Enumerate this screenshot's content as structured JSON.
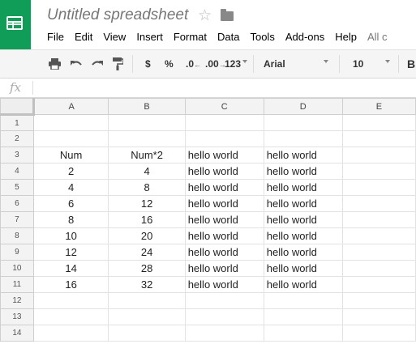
{
  "app": {
    "title": "Untitled spreadsheet",
    "brand_color": "#0f9d58",
    "icons": [
      "sheets-logo-icon",
      "star-icon",
      "folder-icon"
    ]
  },
  "menu": [
    "File",
    "Edit",
    "View",
    "Insert",
    "Format",
    "Data",
    "Tools",
    "Add-ons",
    "Help",
    "All c"
  ],
  "toolbar": {
    "currency": "$",
    "percent": "%",
    "dec_decrease": ".0",
    "dec_increase": ".00",
    "more_formats": "123",
    "font": "Arial",
    "font_size": "10",
    "icons": [
      "print-icon",
      "undo-icon",
      "redo-icon",
      "paint-format-icon"
    ]
  },
  "formula_bar": {
    "label": "fx",
    "value": ""
  },
  "sheet": {
    "columns": [
      "A",
      "B",
      "C",
      "D",
      "E"
    ],
    "rows": [
      {
        "n": "1",
        "cells": [
          "",
          "",
          "",
          ""
        ]
      },
      {
        "n": "2",
        "cells": [
          "",
          "",
          "",
          ""
        ]
      },
      {
        "n": "3",
        "cells": [
          "Num",
          "Num*2",
          "hello world",
          "hello world"
        ]
      },
      {
        "n": "4",
        "cells": [
          "2",
          "4",
          "hello world",
          "hello world"
        ]
      },
      {
        "n": "5",
        "cells": [
          "4",
          "8",
          "hello world",
          "hello world"
        ]
      },
      {
        "n": "6",
        "cells": [
          "6",
          "12",
          "hello world",
          "hello world"
        ]
      },
      {
        "n": "7",
        "cells": [
          "8",
          "16",
          "hello world",
          "hello world"
        ]
      },
      {
        "n": "8",
        "cells": [
          "10",
          "20",
          "hello world",
          "hello world"
        ]
      },
      {
        "n": "9",
        "cells": [
          "12",
          "24",
          "hello world",
          "hello world"
        ]
      },
      {
        "n": "10",
        "cells": [
          "14",
          "28",
          "hello world",
          "hello world"
        ]
      },
      {
        "n": "11",
        "cells": [
          "16",
          "32",
          "hello world",
          "hello world"
        ]
      },
      {
        "n": "12",
        "cells": [
          "",
          "",
          "",
          ""
        ]
      },
      {
        "n": "13",
        "cells": [
          "",
          "",
          "",
          ""
        ]
      },
      {
        "n": "14",
        "cells": [
          "",
          "",
          "",
          ""
        ]
      }
    ]
  }
}
